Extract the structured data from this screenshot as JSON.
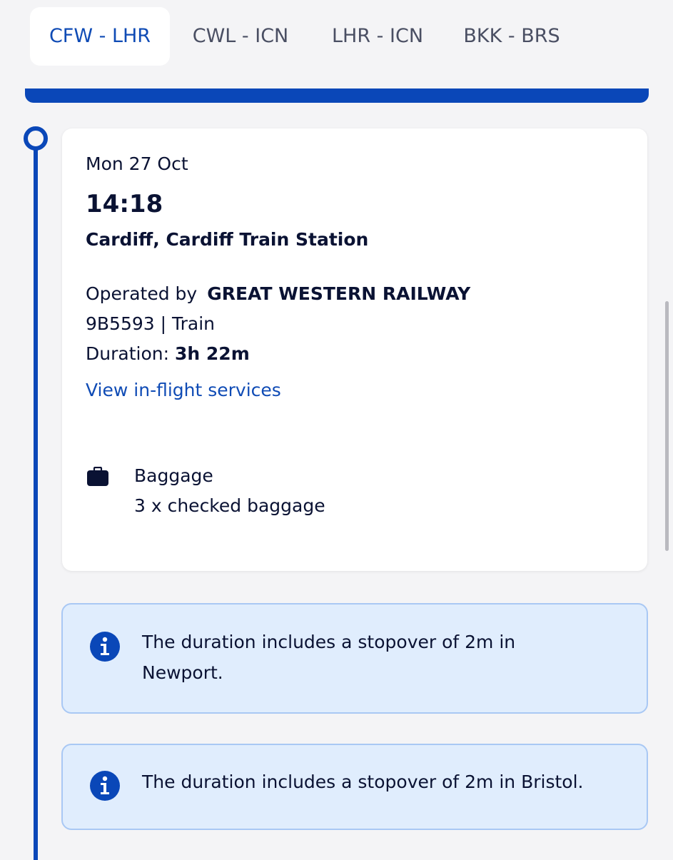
{
  "tabs": [
    {
      "label": "CFW - LHR",
      "active": true
    },
    {
      "label": "CWL - ICN",
      "active": false
    },
    {
      "label": "LHR - ICN",
      "active": false
    },
    {
      "label": "BKK - BRS",
      "active": false
    }
  ],
  "segment": {
    "date": "Mon 27 Oct",
    "time": "14:18",
    "station": "Cardiff, Cardiff Train Station",
    "operated_by_label": "Operated by",
    "operator": "GREAT WESTERN RAILWAY",
    "service_code": "9B5593 | Train",
    "duration_label": "Duration:",
    "duration": "3h 22m",
    "services_link": "View in-flight services",
    "baggage_label": "Baggage",
    "baggage_value": "3 x checked baggage"
  },
  "notices": [
    {
      "text": "The duration includes a stopover of 2m in Newport."
    },
    {
      "text": "The duration includes a stopover of 2m in Bristol."
    }
  ],
  "icons": {
    "timeline": "timeline-origin-icon",
    "baggage": "suitcase-icon",
    "info": "info-icon"
  },
  "colors": {
    "accent": "#0a47b8",
    "link": "#0f4bb5",
    "text": "#0a1233",
    "info_bg": "#e0edfd",
    "info_border": "#a9c8f4"
  }
}
